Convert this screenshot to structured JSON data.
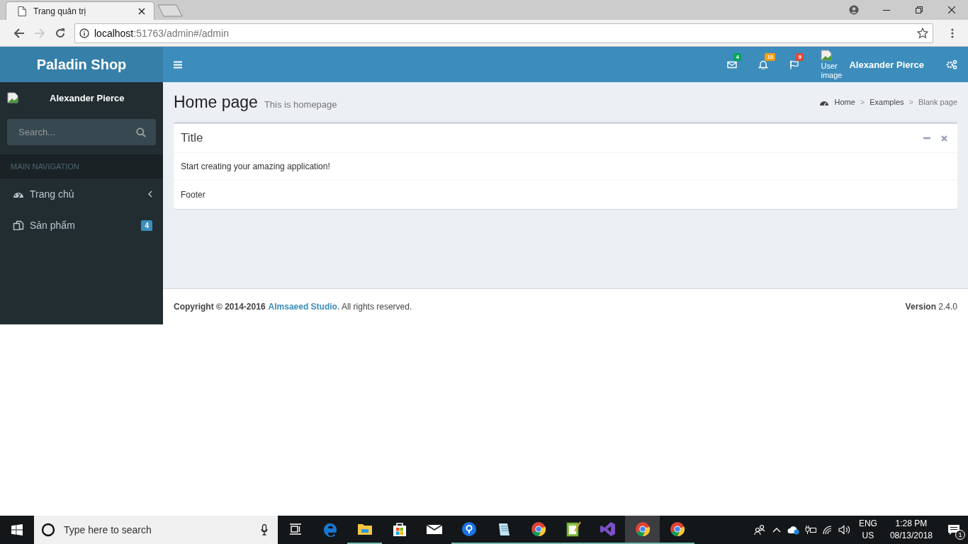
{
  "browser": {
    "tabs": [
      {
        "title": "Trang quản trị",
        "selected": true
      }
    ],
    "address": {
      "host": "localhost",
      "path": ":51763/admin#/admin"
    }
  },
  "header": {
    "brand": "Paladin Shop",
    "notifications": [
      {
        "kind": "mail",
        "count": "4",
        "color": "#00a65a"
      },
      {
        "kind": "bell",
        "count": "10",
        "color": "#f39c12"
      },
      {
        "kind": "flag",
        "count": "9",
        "color": "#dd4b39"
      }
    ],
    "user_image_alt": "User image",
    "user_name": "Alexander Pierce"
  },
  "sidebar": {
    "user_name": "Alexander Pierce",
    "search": {
      "placeholder": "Search..."
    },
    "nav_header": "MAIN NAVIGATION",
    "items": [
      {
        "kind": "dashboard",
        "label": "Trang chủ",
        "expandable": true
      },
      {
        "kind": "copy",
        "label": "Sản phẩm",
        "expandable": false,
        "badge": "4"
      }
    ]
  },
  "content": {
    "title": "Home page",
    "subtitle": "This is homepage",
    "breadcrumb_separator": ">",
    "breadcrumb": [
      {
        "label": "Home",
        "current": false
      },
      {
        "label": "Examples",
        "current": false
      },
      {
        "label": "Blank page",
        "current": true
      }
    ],
    "box": {
      "title": "Title",
      "body": "Start creating your amazing application!",
      "footer": "Footer"
    }
  },
  "footer": {
    "copyright": "Copyright © 2014-2016",
    "link": "Almsaeed Studio",
    "rights": ". All rights reserved.",
    "version": "**Version** 2.4.0"
  },
  "taskbar": {
    "search_placeholder": "Type here to search",
    "apps": [
      {
        "kind": "edge",
        "running": false,
        "selected": false
      },
      {
        "kind": "folder",
        "running": true,
        "selected": false
      },
      {
        "kind": "store",
        "running": false,
        "selected": false
      },
      {
        "kind": "mail",
        "running": false,
        "selected": false
      },
      {
        "kind": "maps",
        "running": true,
        "selected": false
      },
      {
        "kind": "notepad",
        "running": true,
        "selected": false
      },
      {
        "kind": "chrome",
        "running": true,
        "selected": false
      },
      {
        "kind": "editor",
        "running": true,
        "selected": false
      },
      {
        "kind": "studio",
        "running": true,
        "selected": false
      },
      {
        "kind": "chrome",
        "running": true,
        "selected": true
      },
      {
        "kind": "chrome",
        "running": true,
        "selected": false
      }
    ],
    "language": "ENG",
    "region": "US",
    "time": "1:28 PM",
    "date": "08/13/2018",
    "notification_count": "1"
  }
}
